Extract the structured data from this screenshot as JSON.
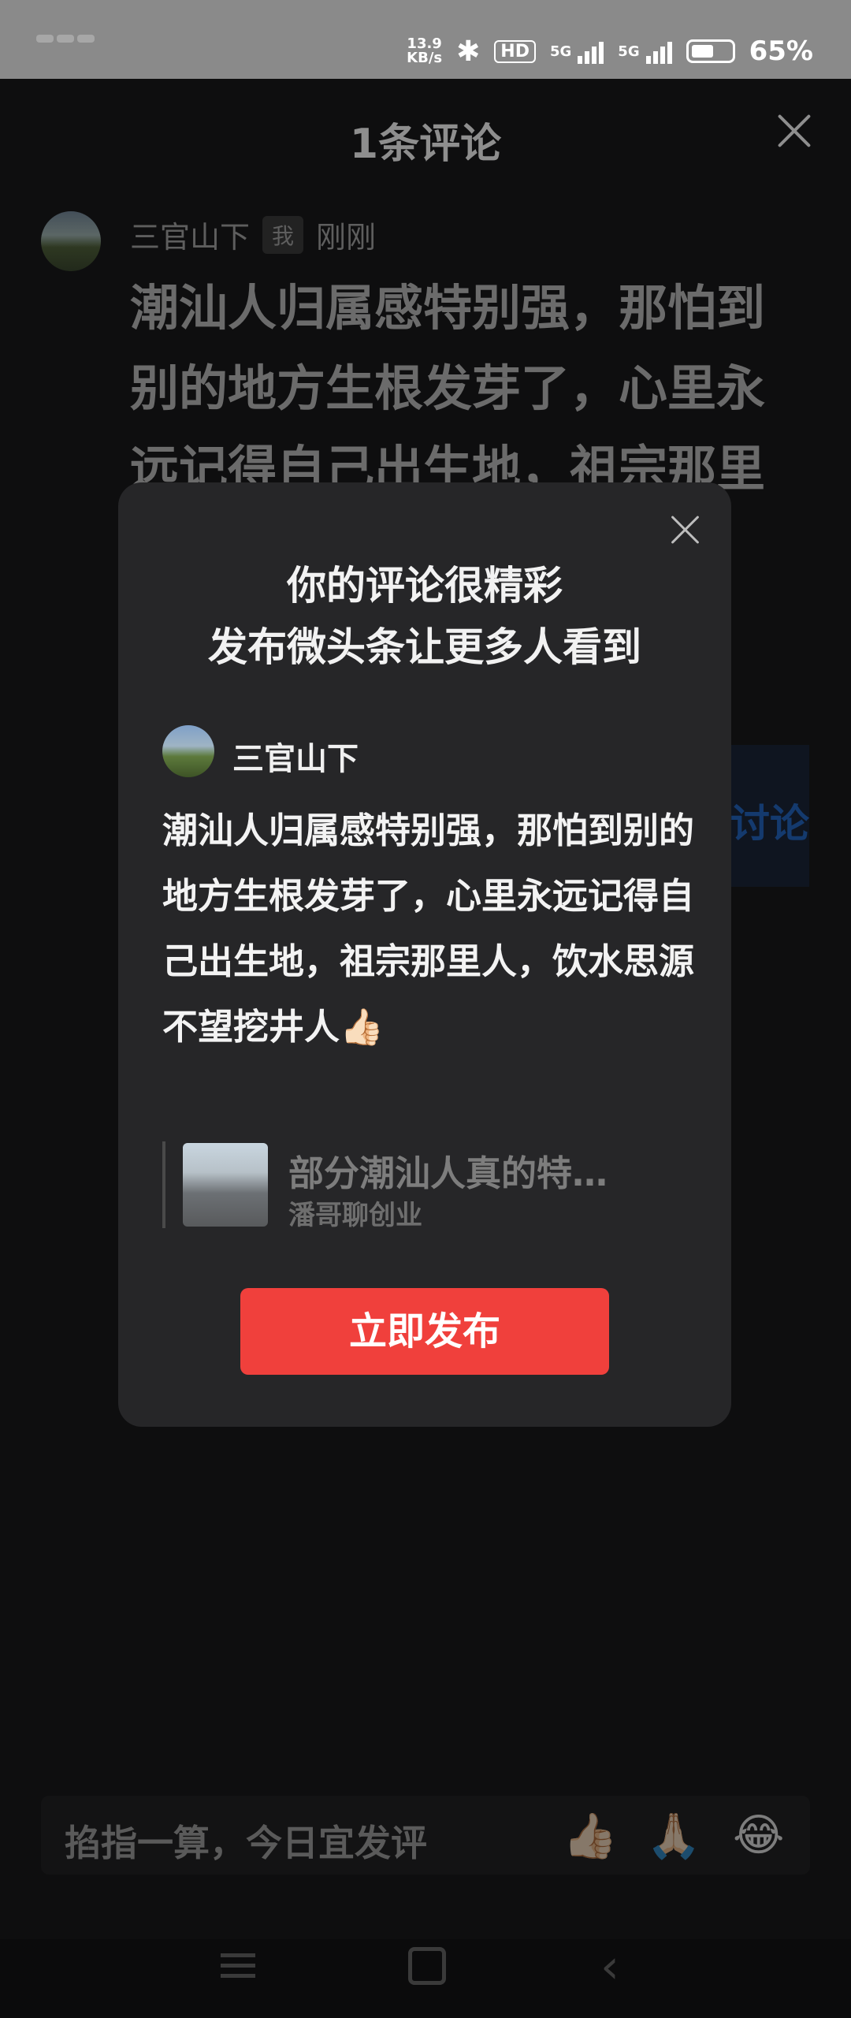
{
  "status_bar": {
    "speed_value": "13.9",
    "speed_unit": "KB/s",
    "hd_label": "HD",
    "network_1": "5G",
    "network_2": "5G",
    "battery_percent": "65%",
    "battery_level": 0.65
  },
  "comment_sheet": {
    "title": "1条评论",
    "comment": {
      "author": "三官山下",
      "me_badge": "我",
      "time": "刚刚",
      "text": "潮汕人归属感特别强，那怕到别的地方生根发芽了，心里永远记得自己出生地，祖宗那里人，饮水思源不望挖"
    },
    "discuss_label": "讨论",
    "input_placeholder": "掐指一算，今日宜发评",
    "emojis": [
      "👍🏻",
      "🙏🏻",
      "😂"
    ]
  },
  "popup": {
    "title_line1": "你的评论很精彩",
    "title_line2": "发布微头条让更多人看到",
    "author": "三官山下",
    "text": "潮汕人归属感特别强，那怕到别的地方生根发芽了，心里永远记得自己出生地，祖宗那里人，饮水思源不望挖井人👍🏻",
    "article_title": "部分潮汕人真的特…",
    "article_author": "潘哥聊创业",
    "publish_button": "立即发布"
  },
  "icons": {
    "close": "close-icon",
    "heart": "broken-heart-icon",
    "bluetooth": "bluetooth-icon",
    "nav_menu": "menu-icon",
    "nav_home": "home-icon",
    "nav_back": "back-icon"
  }
}
